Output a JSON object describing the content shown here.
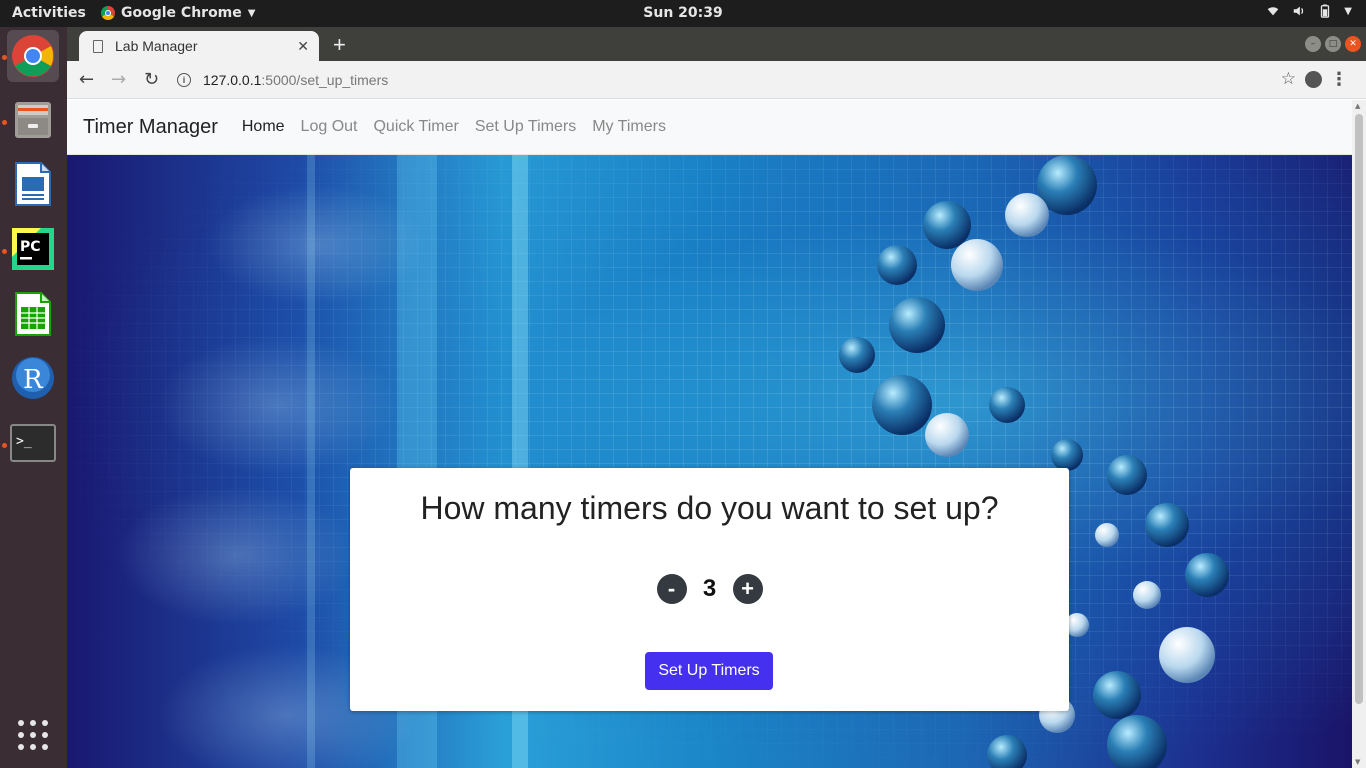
{
  "os": {
    "activities_label": "Activities",
    "app_menu_label": "Google Chrome",
    "clock": "Sun 20:39"
  },
  "dock": {
    "items": [
      "Google Chrome",
      "Files",
      "LibreOffice Impress",
      "PyCharm",
      "LibreOffice Calc",
      "R",
      "Terminal",
      "Show Applications"
    ]
  },
  "browser": {
    "tab_title": "Lab Manager",
    "url_host": "127.0.0.1",
    "url_path": ":5000/set_up_timers"
  },
  "site": {
    "brand": "Timer Manager",
    "nav": [
      "Home",
      "Log Out",
      "Quick Timer",
      "Set Up Timers",
      "My Timers"
    ],
    "active_nav": "Home"
  },
  "card": {
    "heading": "How many timers do you want to set up?",
    "decrement_label": "-",
    "count": "3",
    "increment_label": "+",
    "submit_label": "Set Up Timers"
  },
  "colors": {
    "accent_button": "#4530f0",
    "round_button": "#343a40",
    "ubuntu_orange": "#e95420"
  }
}
